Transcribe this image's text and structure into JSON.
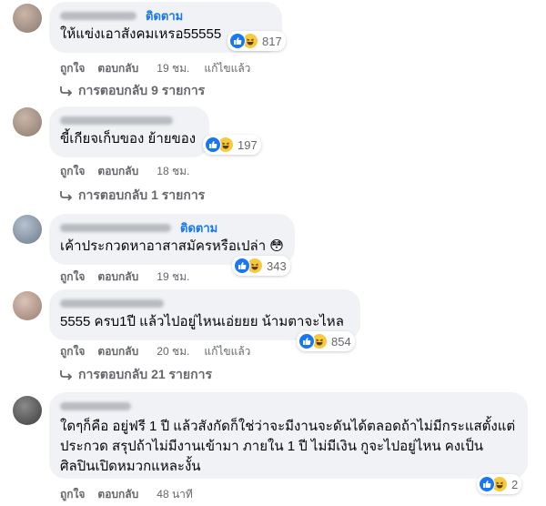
{
  "comments": [
    {
      "follow": "ติดตาม",
      "text": "ให้แข่งเอาสังคมเหรอ55555",
      "reaction_count": "817",
      "like": "ถูกใจ",
      "reply": "ตอบกลับ",
      "time": "19 ชม.",
      "edited": "แก้ไขแล้ว",
      "replies": "การตอบกลับ 9 รายการ"
    },
    {
      "text": "ขี้เกียจเก็บของ ย้ายของ",
      "reaction_count": "197",
      "like": "ถูกใจ",
      "reply": "ตอบกลับ",
      "time": "18 ชม.",
      "replies": "การตอบกลับ 1 รายการ"
    },
    {
      "follow": "ติดตาม",
      "text": "เค้าประกวดหาอาสาสมัครหรือเปล่า 😳",
      "reaction_count": "343",
      "like": "ถูกใจ",
      "reply": "ตอบกลับ",
      "time": "19 ชม."
    },
    {
      "text": "5555 ครบ1ปี แล้วไปอยู่ไหนเอ่ยยย น้ามตาจะไหล",
      "reaction_count": "854",
      "like": "ถูกใจ",
      "reply": "ตอบกลับ",
      "time": "20 ชม.",
      "edited": "แก้ไขแล้ว",
      "replies": "การตอบกลับ 21 รายการ"
    },
    {
      "text_lines": [
        "ใดๆก็คือ อยู่ฟรี 1 ปี แล้วสังกัดก็ใช่ว่าจะมีงานจะดันได้ตลอดถ้าไม่มีกระแสตั้งแต่",
        "ประกวด สรุปถ้าไม่มีงานเข้ามา ภายใน 1 ปี ไม่มีเงิน กูจะไปอยู่ไหน คงเป็น",
        "ศิลปินเปิดหมวกแหละงั้น"
      ],
      "reaction_count": "2",
      "like": "ถูกใจ",
      "reply": "ตอบกลับ",
      "time": "48 นาที"
    }
  ]
}
